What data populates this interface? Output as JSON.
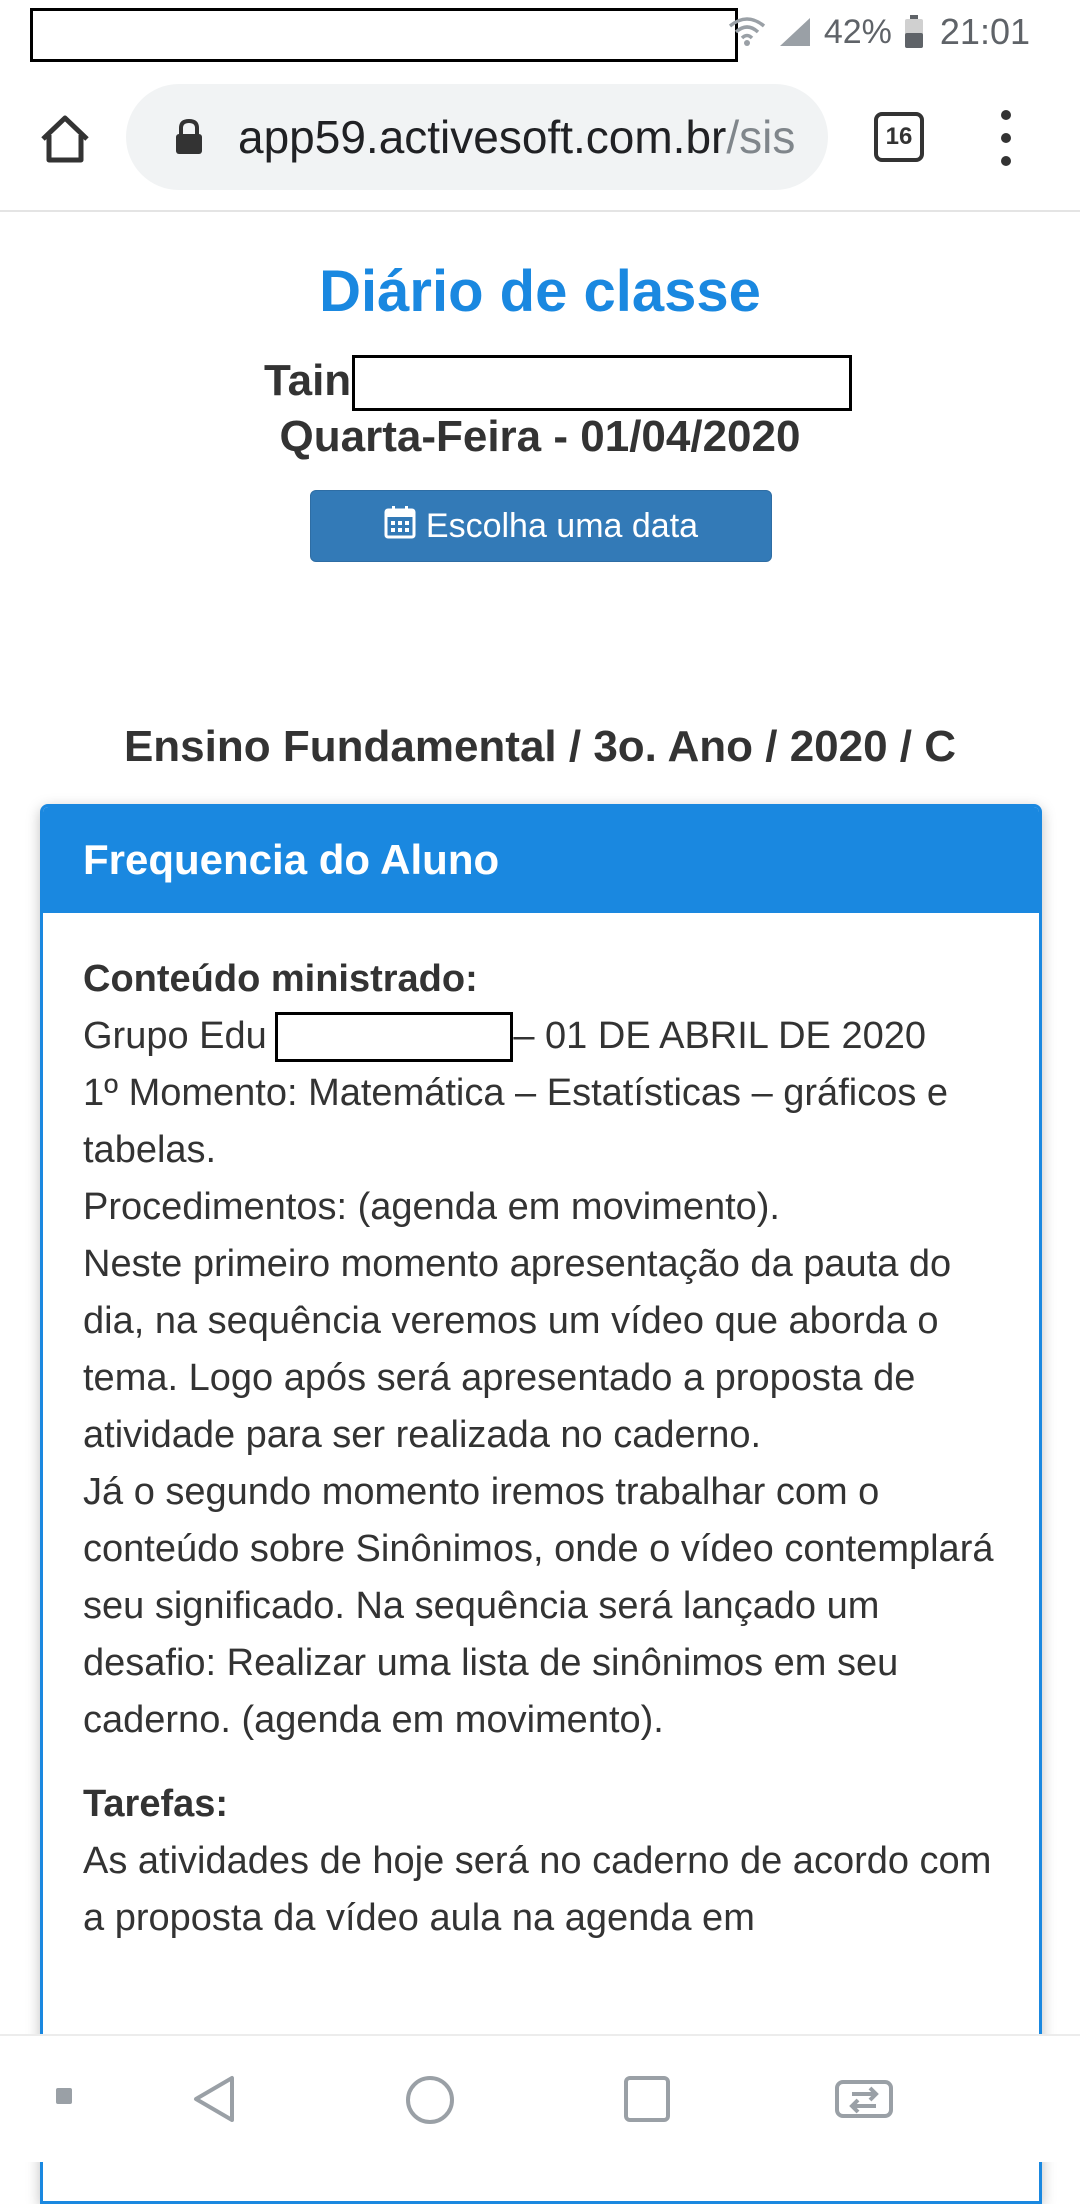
{
  "status_bar": {
    "battery_percent": "42%",
    "time": "21:01",
    "icons": [
      "wifi-icon",
      "signal-icon",
      "battery-icon"
    ]
  },
  "browser": {
    "url_host": "app59.activesoft.com.br",
    "url_path": "/sis",
    "tab_count": "16"
  },
  "page": {
    "title": "Diário de classe",
    "student_name": "Tain",
    "date_line": "Quarta-Feira - 01/04/2020",
    "date_button": "Escolha uma data",
    "class_line": "Ensino Fundamental / 3o. Ano / 2020 / C"
  },
  "panel": {
    "header": "Frequencia do Aluno",
    "content_label": "Conteúdo ministrado:",
    "group_prefix": "Grupo Edu",
    "group_suffix": " – 01 DE ABRIL DE 2020",
    "paragraphs": [
      "1º Momento: Matemática – Estatísticas – gráficos e tabelas.",
      "Procedimentos: (agenda em movimento).",
      "Neste primeiro momento apresentação da pauta do dia, na sequência veremos um vídeo que aborda o tema. Logo após será apresentado a proposta de atividade para ser realizada no caderno.",
      "Já o segundo momento iremos trabalhar com o conteúdo sobre Sinônimos, onde o vídeo contemplará seu significado. Na sequência será lançado um desafio: Realizar uma lista de sinônimos em seu caderno. (agenda em movimento)."
    ],
    "tasks_label": "Tarefas:",
    "tasks_text": "As atividades de hoje será no caderno de acordo com a proposta da vídeo aula na agenda em"
  },
  "colors": {
    "accent": "#1a88e0",
    "button": "#337ab7"
  }
}
